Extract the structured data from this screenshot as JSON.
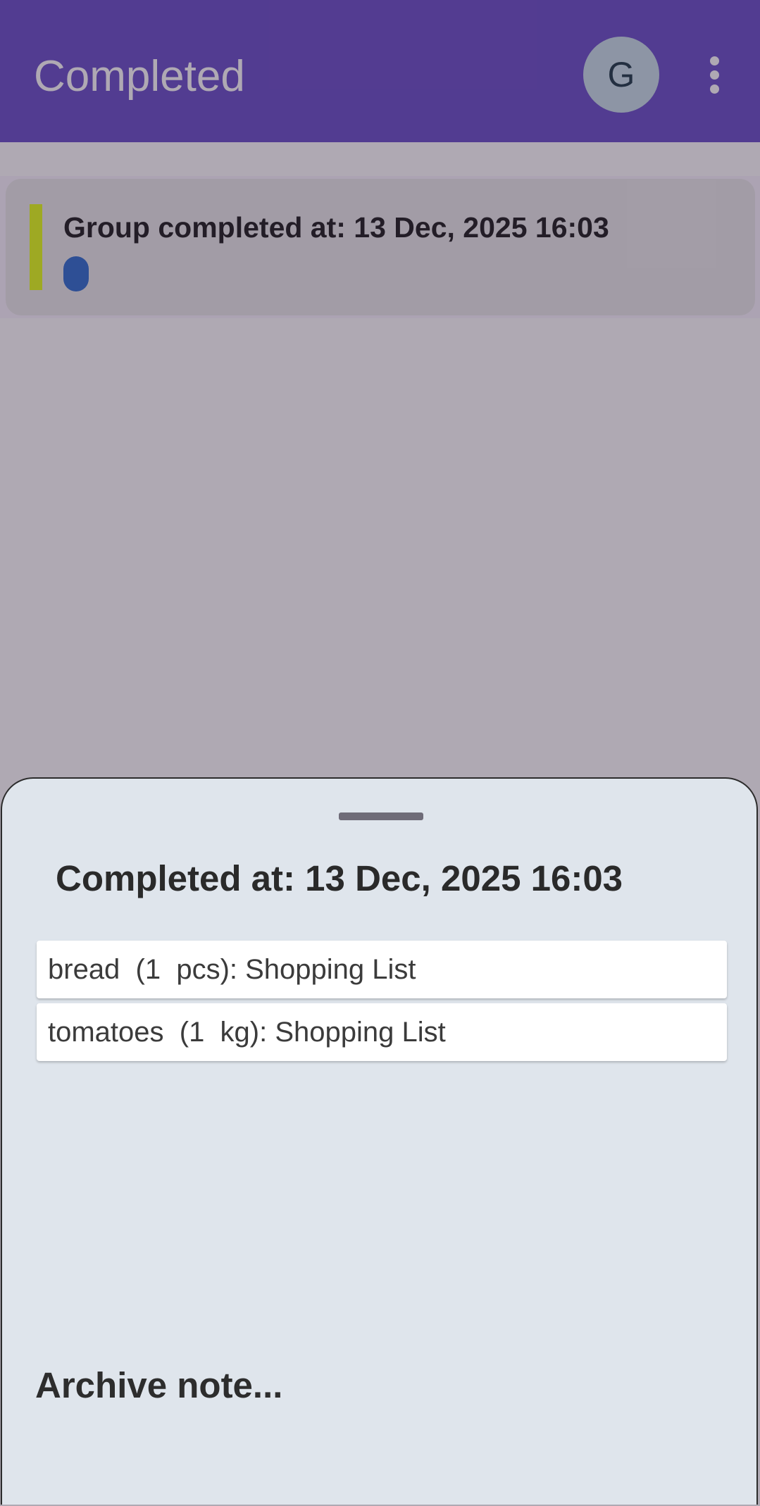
{
  "app_bar": {
    "title": "Completed",
    "avatar_initial": "G",
    "menu_icon": "more-vert-icon",
    "background_color": "#6a4fc8"
  },
  "group_card": {
    "title": "Group completed at: 13 Dec, 2025 16:03",
    "accent_color": "#e4ff17",
    "badge_color": "#2f6fcf"
  },
  "sheet": {
    "title": "Completed at: 13 Dec, 2025 16:03",
    "items": [
      {
        "label": "bread  (1  pcs): Shopping List"
      },
      {
        "label": "tomatoes  (1  kg): Shopping List"
      }
    ],
    "archive_note_label": "Archive note..."
  }
}
